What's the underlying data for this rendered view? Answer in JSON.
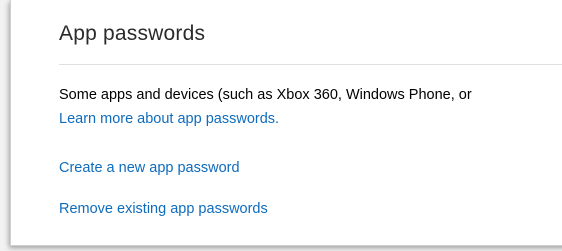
{
  "section": {
    "title": "App passwords",
    "description": "Some apps and devices (such as Xbox 360, Windows Phone, or",
    "learn_more_link": "Learn more about app passwords.",
    "create_link": "Create a new app password",
    "remove_link": "Remove existing app passwords"
  },
  "colors": {
    "link": "#0f6cbd",
    "text": "#000000",
    "title": "#2b2b2b"
  }
}
